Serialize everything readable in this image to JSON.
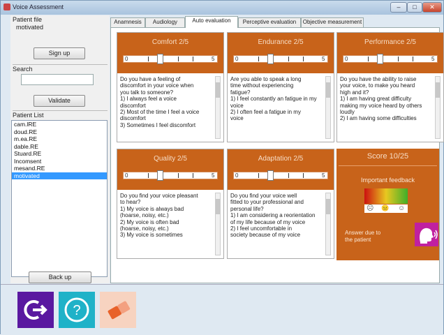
{
  "window": {
    "title": "Voice Assessment",
    "min_glyph": "–",
    "max_glyph": "□",
    "close_glyph": "✕"
  },
  "left_panel": {
    "patient_file_label": "Patient file",
    "patient_file_value": "motivated",
    "sign_up_button": "Sign up",
    "search_label": "Search",
    "search_placeholder": "",
    "validate_button": "Validate",
    "patient_list_label": "Patient List",
    "patients": [
      "cam.lRE",
      "doud.RE",
      "m.ea.RE",
      "dable.RE",
      "Stuard.RE",
      "Incomsent",
      "mesand.RE",
      "motivated"
    ],
    "selected_index": 7,
    "back_button": "Back up"
  },
  "tabs": [
    {
      "label": "Anamnesis",
      "active": false
    },
    {
      "label": "Audiology",
      "active": false
    },
    {
      "label": "Auto evaluation",
      "active": true
    },
    {
      "label": "Perceptive evaluation",
      "active": false
    },
    {
      "label": "Objective measurement",
      "active": false
    }
  ],
  "cards": [
    {
      "title": "Comfort 2/5",
      "value": 2,
      "max": 5,
      "min_label": "0",
      "max_label": "5",
      "lines": [
        "Do you have a feeling of",
        "discomfort in your voice when",
        "you talk to someone?",
        "1) I always feel a voice",
        "discomfort",
        "2) Most of the time I feel a voice discomfort",
        "3) Sometimes I feel discomfort"
      ]
    },
    {
      "title": "Endurance 2/5",
      "value": 2,
      "max": 5,
      "min_label": "0",
      "max_label": "5",
      "lines": [
        "Are you able to speak a long",
        "time without experiencing",
        "fatigue?",
        "1) I feel constantly an fatigue in my",
        "voice",
        "2) I often feel a fatigue in my",
        "voice"
      ]
    },
    {
      "title": "Performance 2/5",
      "value": 2,
      "max": 5,
      "min_label": "0",
      "max_label": "5",
      "lines": [
        "Do you have the ability to raise",
        "your voice, to make you heard",
        "high and it?",
        "1) I am having great difficulty",
        "making my voice heard by others",
        "loudly",
        "2) I am having some difficulties"
      ]
    },
    {
      "title": "Quality 2/5",
      "value": 2,
      "max": 5,
      "min_label": "0",
      "max_label": "5",
      "lines": [
        "Do you find your voice pleasant",
        "to hear?",
        "1) My voice is always bad",
        "(hoarse, noisy, etc.)",
        "2) My voice is often bad",
        "(hoarse, noisy, etc.)",
        "3) My voice is sometimes"
      ]
    },
    {
      "title": "Adaptation 2/5",
      "value": 2,
      "max": 5,
      "min_label": "0",
      "max_label": "5",
      "lines": [
        "Do you find your voice well",
        "fitted to your professional and",
        "personal life?",
        "1) I am considering a reorientation",
        "of my life because of my voice",
        "2) I feel uncomfortable in",
        "society because of my voice"
      ]
    }
  ],
  "score": {
    "title": "Score 10/25",
    "feedback_label": "Important feedback",
    "face_sad": "☹",
    "face_neutral": "😐",
    "face_happy": "☺",
    "note_line1": "Answer due to",
    "note_line2": "the patient"
  },
  "bottom_bar": {
    "exit_glyph": "➜",
    "help_glyph": "?"
  }
}
